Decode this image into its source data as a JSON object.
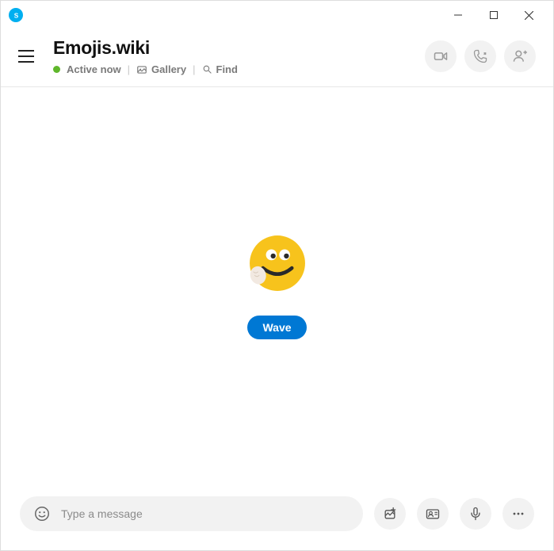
{
  "header": {
    "title": "Emojis.wiki",
    "status": "Active now",
    "gallery_label": "Gallery",
    "find_label": "Find"
  },
  "conversation": {
    "wave_label": "Wave"
  },
  "input": {
    "placeholder": "Type a message"
  }
}
